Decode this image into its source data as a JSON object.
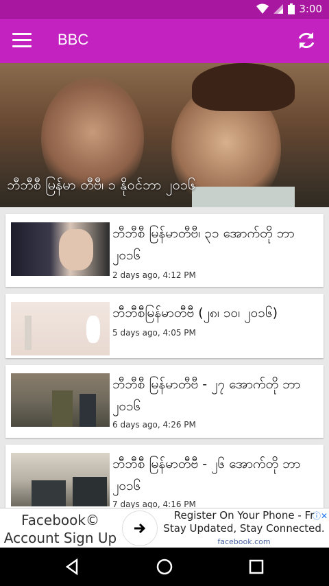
{
  "status": {
    "time": "3:00"
  },
  "appbar": {
    "title": "BBC"
  },
  "hero": {
    "caption": "ဘီဘီစီ မြန်မာ တီဗီ၊ ၁ နိုဝင်ဘာ ၂၀၁၆"
  },
  "articles": [
    {
      "title": "ဘီဘီစီ မြန်မာတီဗီ၊ ၃၁ အောက်တို ဘာ ၂၀၁၆",
      "time": "2 days ago, 4:12 PM"
    },
    {
      "title": "ဘီဘီစီမြန်မာတီဗီ (၂၈၊ ၁၀၊ ၂၀၁၆)",
      "time": "5 days ago, 4:05 PM"
    },
    {
      "title": "ဘီဘီစီ မြန်မာတီဗီ - ၂၇ အောက်တို ဘာ ၂၀၁၆",
      "time": "6 days ago, 4:26 PM"
    },
    {
      "title": "ဘီဘီစီ မြန်မာတီဗီ - ၂၆ အောက်တို ဘာ ၂၀၁၆",
      "time": "7 days ago, 4:16 PM"
    }
  ],
  "ad": {
    "left_line1": "Facebook©",
    "left_line2": "Account Sign Up",
    "right_line1": "Register On Your Phone - Fr",
    "right_line2": "Stay Updated, Stay Connected.",
    "right_link": "facebook.com"
  },
  "colors": {
    "statusbar": "#a8179f",
    "appbar": "#c422c0"
  }
}
